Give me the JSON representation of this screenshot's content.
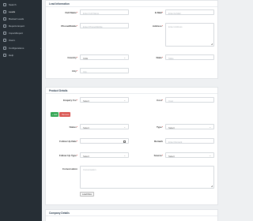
{
  "sidebar": {
    "items": [
      {
        "label": "Search",
        "active": false
      },
      {
        "label": "Leads",
        "active": true
      },
      {
        "label": "Booked Leads",
        "active": false
      },
      {
        "label": "Reports Export",
        "active": false
      },
      {
        "label": "Import/Export",
        "active": false
      },
      {
        "label": "Users",
        "active": false
      },
      {
        "label": "Configurations",
        "active": false,
        "has_caret": true
      },
      {
        "label": "Help",
        "active": false
      }
    ]
  },
  "lead_info": {
    "title": "Lead Information",
    "full_name": {
      "label": "Full Name",
      "placeholder": "Enter Full Name"
    },
    "email": {
      "label": "E-Mail",
      "placeholder": "Enter E-Mail"
    },
    "phone": {
      "label": "Phone/Mobile",
      "placeholder": "Enter Phone/Mobile"
    },
    "address": {
      "label": "Address",
      "placeholder": "Enter Address"
    },
    "country": {
      "label": "Country",
      "value": "India"
    },
    "state": {
      "label": "State",
      "placeholder": "State"
    },
    "city": {
      "label": "City",
      "placeholder": "City"
    }
  },
  "product_details": {
    "title": "Product Details",
    "enquiry_for": {
      "label": "Enquiry For",
      "value": "Select"
    },
    "cost": {
      "label": "Cost",
      "placeholder": "Cost"
    },
    "add_label": "+ Add",
    "remove_label": "- Remove",
    "status": {
      "label": "Status",
      "value": "Select"
    },
    "type": {
      "label": "Type",
      "value": "Select"
    },
    "follow_up_date": {
      "label": "Follow Up Date",
      "placeholder": ""
    },
    "remark": {
      "label": "Remark",
      "placeholder": "Enter Remark"
    },
    "follow_up_type": {
      "label": "Follow Up Type",
      "value": "Select"
    },
    "source": {
      "label": "Source",
      "value": "Select"
    },
    "conversation": {
      "label": "Conversation",
      "placeholder": "Conversation"
    },
    "upload_label": "Load Files"
  },
  "company_details": {
    "title": "Company Details"
  },
  "colors": {
    "sidebar": "#262e35",
    "green": "#2ea44f",
    "red": "#d9534f"
  }
}
